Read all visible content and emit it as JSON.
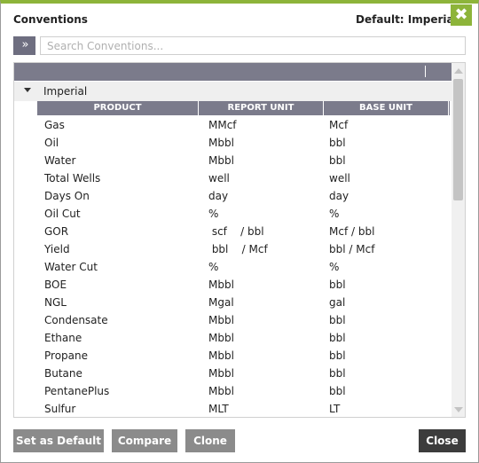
{
  "header": {
    "title": "Conventions",
    "default_label": "Default: Imperial",
    "close_glyph": "✖"
  },
  "toolbar": {
    "expand_glyph": "»",
    "search_placeholder": "Search Conventions...",
    "search_value": ""
  },
  "grid": {
    "group_label": "Imperial",
    "columns": [
      "PRODUCT",
      "REPORT UNIT",
      "BASE UNIT"
    ],
    "rows": [
      {
        "product": "Gas",
        "report": "MMcf",
        "base": "Mcf"
      },
      {
        "product": "Oil",
        "report": "Mbbl",
        "base": "bbl"
      },
      {
        "product": "Water",
        "report": "Mbbl",
        "base": "bbl"
      },
      {
        "product": "Total Wells",
        "report": "well",
        "base": "well"
      },
      {
        "product": "Days On",
        "report": "day",
        "base": "day"
      },
      {
        "product": "Oil Cut",
        "report": "%",
        "base": "%"
      },
      {
        "product": "GOR",
        "report": " scf    / bbl",
        "base": "Mcf / bbl"
      },
      {
        "product": "Yield",
        "report": " bbl    / Mcf",
        "base": "bbl / Mcf"
      },
      {
        "product": "Water Cut",
        "report": "%",
        "base": "%"
      },
      {
        "product": "BOE",
        "report": "Mbbl",
        "base": "bbl"
      },
      {
        "product": "NGL",
        "report": "Mgal",
        "base": "gal"
      },
      {
        "product": "Condensate",
        "report": "Mbbl",
        "base": "bbl"
      },
      {
        "product": "Ethane",
        "report": "Mbbl",
        "base": "bbl"
      },
      {
        "product": "Propane",
        "report": "Mbbl",
        "base": "bbl"
      },
      {
        "product": "Butane",
        "report": "Mbbl",
        "base": "bbl"
      },
      {
        "product": "PentanePlus",
        "report": "Mbbl",
        "base": "bbl"
      },
      {
        "product": "Sulfur",
        "report": "MLT",
        "base": "LT"
      }
    ]
  },
  "footer": {
    "set_default_label": "Set as Default",
    "compare_label": "Compare",
    "clone_label": "Clone",
    "close_label": "Close"
  },
  "colors": {
    "accent": "#8db43a",
    "header_bg": "#7b7b8b",
    "button_bg": "#8b8b8b",
    "close_button_bg": "#3c3c3c"
  }
}
